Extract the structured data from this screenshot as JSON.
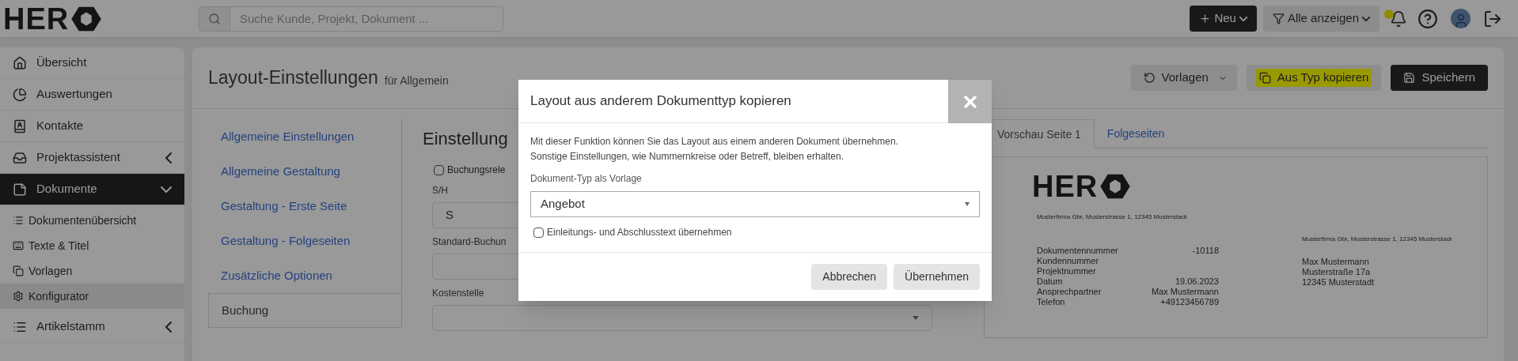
{
  "header": {
    "logo": "HER",
    "search": {
      "placeholder": "Suche Kunde, Projekt, Dokument ..."
    },
    "new_button": "Neu",
    "filter_button": "Alle anzeigen",
    "notification": true
  },
  "sidebar": {
    "items": [
      {
        "label": "Übersicht",
        "selected": false
      },
      {
        "label": "Auswertungen",
        "selected": false
      },
      {
        "label": "Kontakte",
        "selected": false
      },
      {
        "label": "Projektassistent",
        "selected": false,
        "expanded": false
      },
      {
        "label": "Dokumente",
        "selected": true,
        "expanded": true,
        "children": [
          {
            "label": "Dokumentenübersicht",
            "selected": false
          },
          {
            "label": "Texte & Titel",
            "selected": false
          },
          {
            "label": "Vorlagen",
            "selected": false
          },
          {
            "label": "Konfigurator",
            "selected": true
          }
        ]
      },
      {
        "label": "Artikelstamm",
        "selected": false,
        "expanded": false
      }
    ]
  },
  "page": {
    "title": "Layout-Einstellungen",
    "subtitle": "für Allgemein",
    "toolbar": [
      {
        "label": "Vorlagen",
        "kind": "dropdown",
        "highlighted": false
      },
      {
        "label": "Aus Typ kopieren",
        "kind": "copy",
        "highlighted": true
      },
      {
        "label": "Speichern",
        "kind": "save",
        "highlighted": false
      }
    ],
    "settings_nav": [
      {
        "label": "Allgemeine Einstellungen",
        "selected": false
      },
      {
        "label": "Allgemeine Gestaltung",
        "selected": false
      },
      {
        "label": "Gestaltung - Erste Seite",
        "selected": false
      },
      {
        "label": "Gestaltung - Folgeseiten",
        "selected": false
      },
      {
        "label": "Zusätzliche Optionen",
        "selected": false
      },
      {
        "label": "Buchung",
        "selected": true
      }
    ],
    "form": {
      "heading": "Einstellung",
      "checkbox": {
        "label": "Buchungsrele",
        "checked": false
      },
      "fields": [
        {
          "label": "S/H",
          "value": "S",
          "kind": "input"
        },
        {
          "label": "Standard-Buchun",
          "kind": "input"
        },
        {
          "label": "Kostenstelle",
          "kind": "select"
        }
      ]
    },
    "preview": {
      "tabs": [
        {
          "label": "Vorschau Seite 1",
          "selected": true
        },
        {
          "label": "Folgeseiten",
          "selected": false
        }
      ],
      "document": {
        "logo": "HER",
        "sender_line": "Musterfirma Gbr, Musterstrasse 1, 12345 Musterstadr",
        "window_sender_line": "Musterfirma Gbr, Musterstrasse 1, 12345 Musterstadr",
        "recipient": [
          "Max Mustermann",
          "Musterstraße 17a",
          "12345 Musterstadt"
        ],
        "info": [
          {
            "label": "Dokumentennummer",
            "value": "-10118"
          },
          {
            "label": "Kundennummer"
          },
          {
            "label": "Projektnummer"
          },
          {
            "label": "Datum",
            "value": "19.06.2023"
          },
          {
            "label": "Ansprechpartner",
            "value": "Max Mustermann"
          },
          {
            "label": "Telefon",
            "value": "+49123456789"
          }
        ]
      }
    }
  },
  "modal": {
    "title": "Layout aus anderem Dokumenttyp kopieren",
    "text": "Mit dieser Funktion können Sie das Layout aus einem anderen Dokument übernehmen. Sonstige Einstellungen, wie Nummernkreise oder Betreff, bleiben erhalten.",
    "select": {
      "label": "Dokument-Typ als Vorlage",
      "value": "Angebot"
    },
    "checkbox": {
      "label": "Einleitungs- und Abschlusstext übernehmen",
      "checked": false
    },
    "buttons": [
      "Abbrechen",
      "Übernehmen"
    ]
  }
}
